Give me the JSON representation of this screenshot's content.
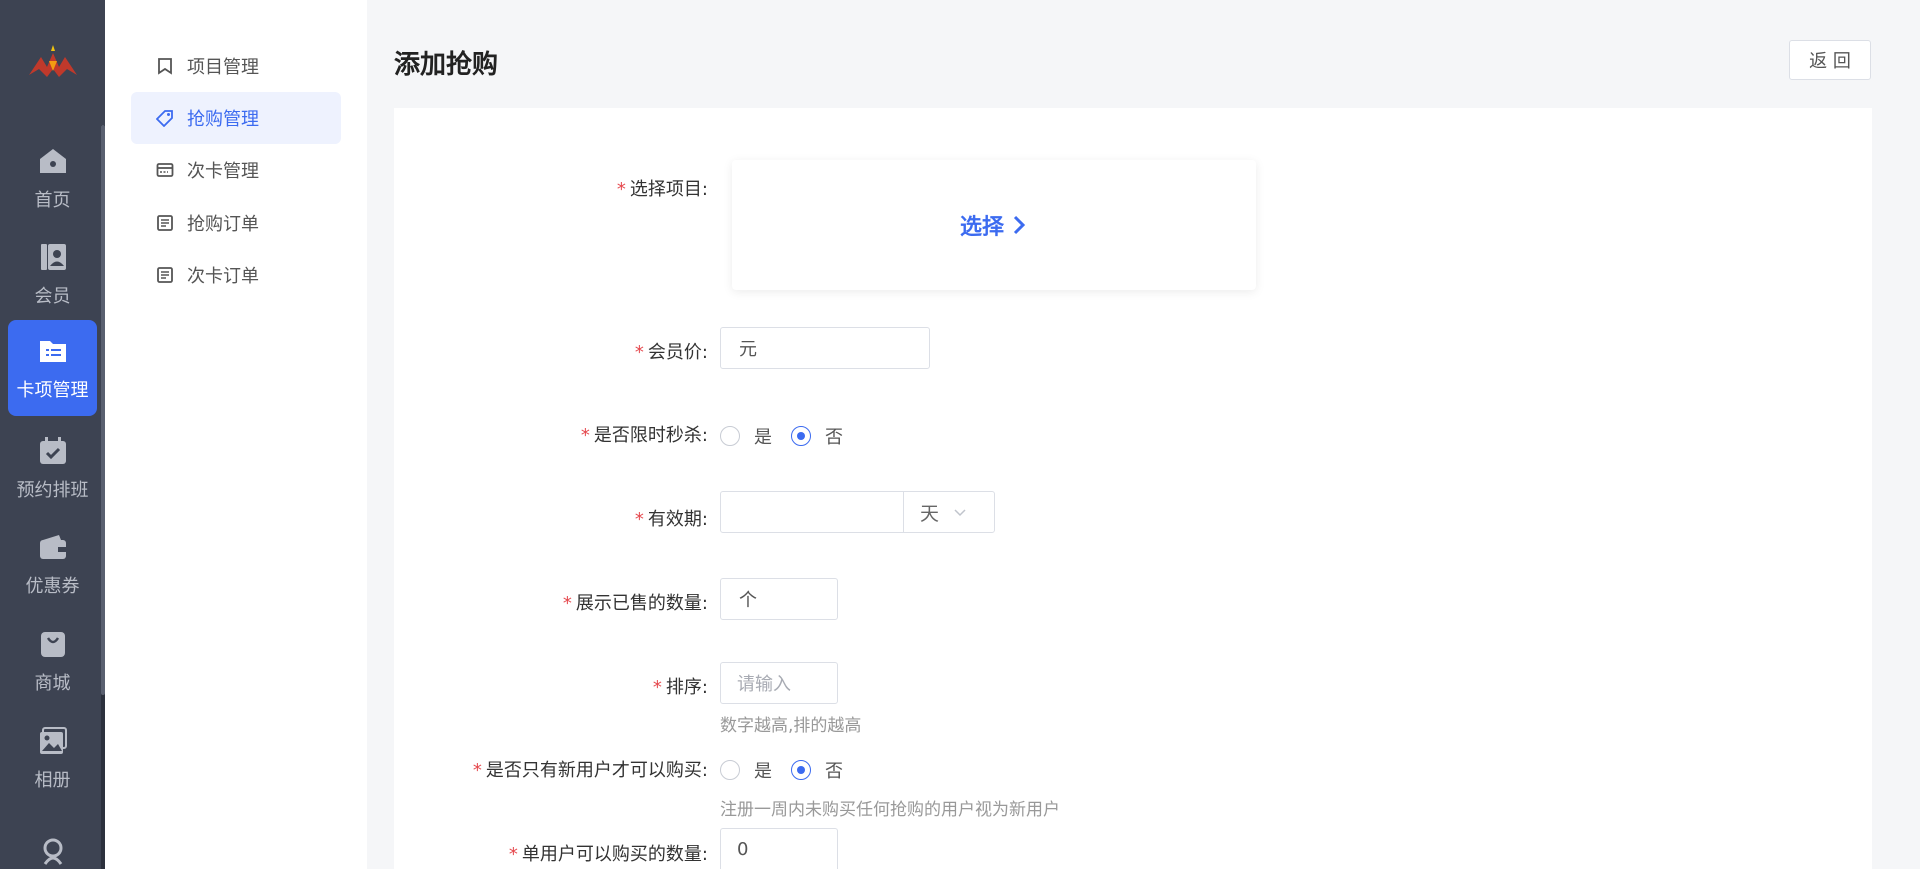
{
  "nav": {
    "items": [
      {
        "label": "首页",
        "icon": "home-icon"
      },
      {
        "label": "会员",
        "icon": "member-icon"
      },
      {
        "label": "卡项管理",
        "icon": "card-folder-icon",
        "active": true
      },
      {
        "label": "预约排班",
        "icon": "calendar-check-icon"
      },
      {
        "label": "优惠券",
        "icon": "wallet-icon"
      },
      {
        "label": "商城",
        "icon": "shopping-bag-icon"
      },
      {
        "label": "相册",
        "icon": "image-icon"
      },
      {
        "label": "",
        "icon": "partial-icon"
      }
    ]
  },
  "submenu": {
    "items": [
      {
        "label": "项目管理",
        "icon": "bookmark-icon"
      },
      {
        "label": "抢购管理",
        "icon": "tag-icon",
        "active": true
      },
      {
        "label": "次卡管理",
        "icon": "card-icon"
      },
      {
        "label": "抢购订单",
        "icon": "document-icon"
      },
      {
        "label": "次卡订单",
        "icon": "document-icon"
      }
    ]
  },
  "header": {
    "title": "添加抢购",
    "back_label": "返 回"
  },
  "form": {
    "project_label": "选择项目:",
    "select_label": "选择",
    "member_price_label": "会员价:",
    "member_price_unit": "元",
    "flash_sale_label": "是否限时秒杀:",
    "flash_yes": "是",
    "flash_no": "否",
    "validity_label": "有效期:",
    "validity_unit": "天",
    "sold_count_label": "展示已售的数量:",
    "sold_count_unit": "个",
    "sort_label": "排序:",
    "sort_placeholder": "请输入",
    "sort_hint": "数字越高,排的越高",
    "new_user_label": "是否只有新用户才可以购买:",
    "new_user_yes": "是",
    "new_user_no": "否",
    "new_user_hint": "注册一周内未购买任何抢购的用户视为新用户",
    "per_user_label": "单用户可以购买的数量:",
    "per_user_value": "0"
  },
  "colors": {
    "accent": "#3c6bf0",
    "nav_bg": "#3d4352",
    "required": "#e5484d"
  }
}
